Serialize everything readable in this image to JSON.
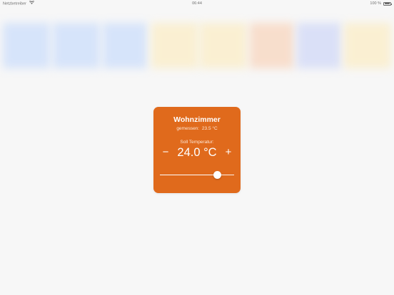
{
  "status_bar": {
    "carrier": "Netzbetreiber",
    "time": "06:44",
    "battery_text": "100 %",
    "wifi_icon": "wifi-icon",
    "battery_icon": "battery-icon"
  },
  "background_tiles": {
    "colors": [
      "#bcd4fb",
      "#bcd4fb",
      "#bcd4fb",
      "#fbe9b4",
      "#fbe9b4",
      "#f7c9a9",
      "#c3cdf6",
      "#fbe9b4"
    ]
  },
  "thermostat_card": {
    "room_name": "Wohnzimmer",
    "measured_label": "gemessen:",
    "measured_value": "23.5 °C",
    "target_label": "Soll Temperatur:",
    "target_value": "24.0 °C",
    "minus_label": "−",
    "plus_label": "+",
    "slider_fraction": 0.77,
    "accent_color": "#e06a1c"
  }
}
